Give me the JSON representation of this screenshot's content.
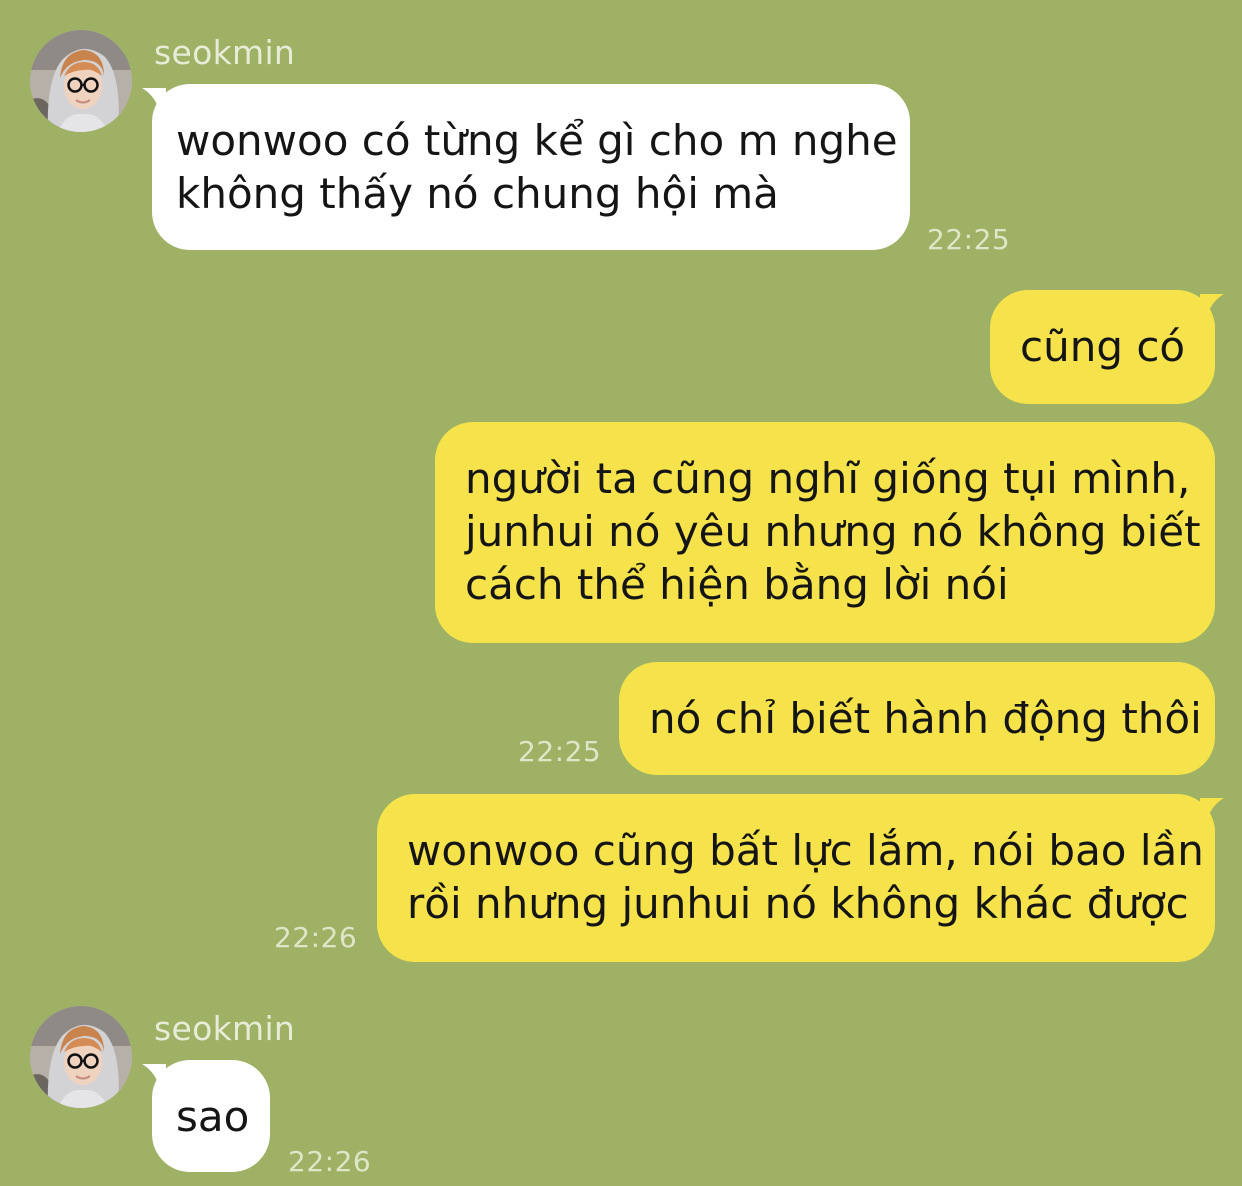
{
  "chat": {
    "contact_name": "seokmin",
    "colors": {
      "background": "#9eb164",
      "incoming_bubble": "#ffffff",
      "outgoing_bubble": "#f6e34c",
      "timestamp": "#dfe6c7"
    },
    "messages": [
      {
        "direction": "incoming",
        "sender": "seokmin",
        "lines": [
          "wonwoo có từng kể gì cho m nghe",
          "không thấy nó chung hội mà"
        ],
        "time": "22:25"
      },
      {
        "direction": "outgoing",
        "lines": [
          "cũng có"
        ],
        "time": ""
      },
      {
        "direction": "outgoing",
        "lines": [
          "người ta cũng nghĩ giống tụi mình,",
          "junhui nó yêu nhưng nó không biết",
          "cách thể hiện bằng lời nói"
        ],
        "time": ""
      },
      {
        "direction": "outgoing",
        "lines": [
          "nó chỉ biết hành động thôi"
        ],
        "time": "22:25"
      },
      {
        "direction": "outgoing",
        "lines": [
          "wonwoo cũng bất lực lắm, nói bao lần",
          "rồi nhưng junhui nó không khác được"
        ],
        "time": "22:26"
      },
      {
        "direction": "incoming",
        "sender": "seokmin",
        "lines": [
          "sao"
        ],
        "time": "22:26"
      }
    ]
  }
}
